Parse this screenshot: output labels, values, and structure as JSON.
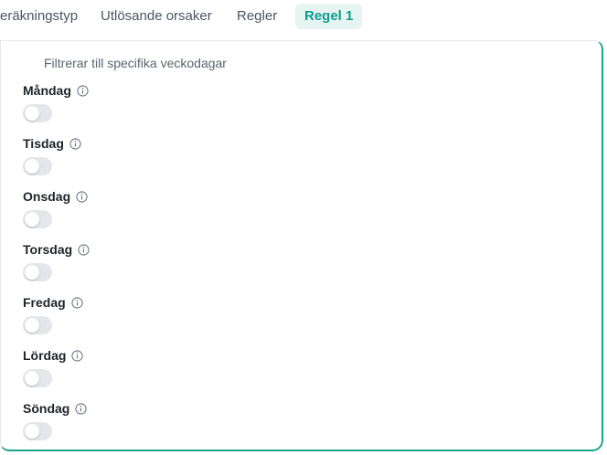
{
  "tabs": [
    {
      "label": "eräkningstyp",
      "active": false
    },
    {
      "label": "Utlösande orsaker",
      "active": false
    },
    {
      "label": "Regler",
      "active": false
    },
    {
      "label": "Regel 1",
      "active": true
    }
  ],
  "panel": {
    "description": "Filtrerar till specifika veckodagar",
    "days": [
      {
        "label": "Måndag",
        "enabled": false,
        "icon": "info-icon"
      },
      {
        "label": "Tisdag",
        "enabled": false,
        "icon": "info-icon"
      },
      {
        "label": "Onsdag",
        "enabled": false,
        "icon": "info-icon"
      },
      {
        "label": "Torsdag",
        "enabled": false,
        "icon": "info-icon"
      },
      {
        "label": "Fredag",
        "enabled": false,
        "icon": "info-icon"
      },
      {
        "label": "Lördag",
        "enabled": false,
        "icon": "info-icon"
      },
      {
        "label": "Söndag",
        "enabled": false,
        "icon": "info-icon"
      }
    ]
  },
  "colors": {
    "accent": "#0f9b8e",
    "active_tab_bg": "#e6f4f2",
    "toggle_off": "#e4e6ea"
  }
}
